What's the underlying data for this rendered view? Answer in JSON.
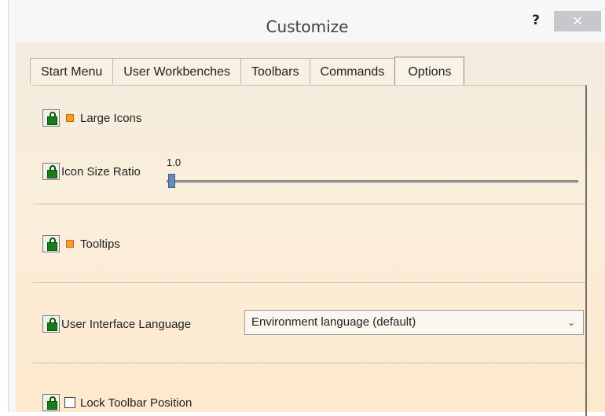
{
  "window": {
    "title": "Customize",
    "help_label": "?",
    "close_label": "×"
  },
  "tabs": [
    {
      "label": "Start Menu",
      "active": false
    },
    {
      "label": "User Workbenches",
      "active": false
    },
    {
      "label": "Toolbars",
      "active": false
    },
    {
      "label": "Commands",
      "active": false
    },
    {
      "label": "Options",
      "active": true
    }
  ],
  "options": {
    "large_icons": {
      "label": "Large Icons",
      "checked": true
    },
    "icon_size_ratio": {
      "label": "Icon Size Ratio",
      "value": "1.0",
      "fraction": 0.02
    },
    "tooltips": {
      "label": "Tooltips",
      "checked": true
    },
    "ui_language": {
      "label": "User Interface Language",
      "selected": "Environment language (default)"
    },
    "lock_toolbar": {
      "label": "Lock Toolbar Position",
      "checked": false
    }
  },
  "icons": {
    "lock": "lock-icon",
    "dropdown": "chevron-down-icon"
  },
  "colors": {
    "orange_checkbox": "#f0a030",
    "lock_green": "#1a7b1a",
    "close_button": "#c7c7cc"
  }
}
